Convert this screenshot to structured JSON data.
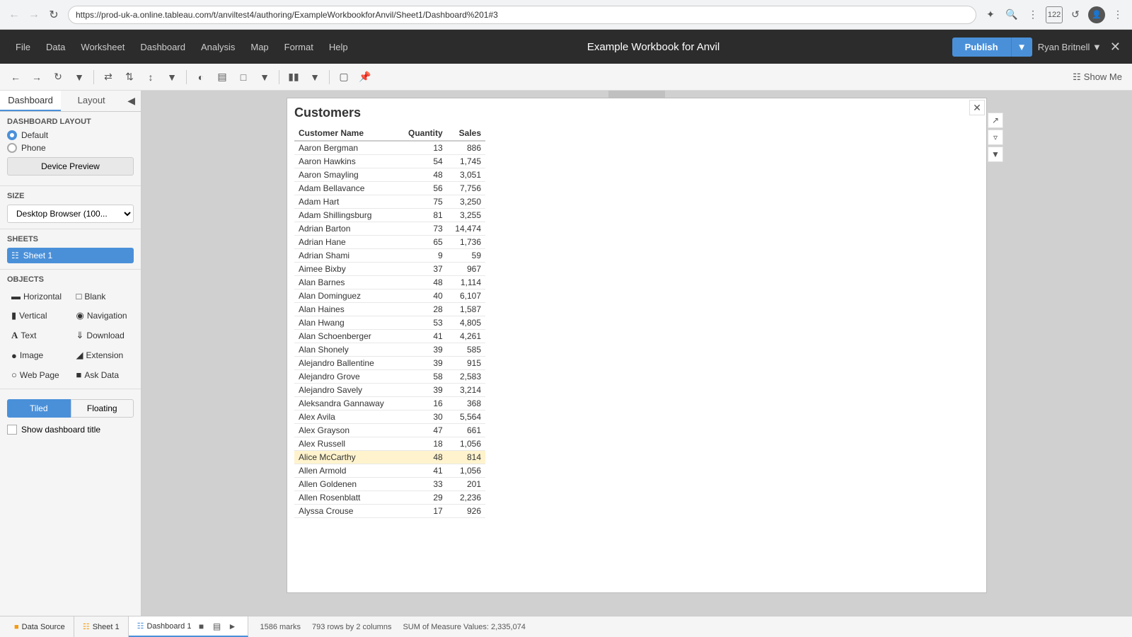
{
  "browser": {
    "url": "https://prod-uk-a.online.tableau.com/t/anviltest4/authoring/ExampleWorkbookforAnvil/Sheet1/Dashboard%201#3",
    "tab_count": "122"
  },
  "app": {
    "title": "Example Workbook for Anvil",
    "menu_items": [
      "File",
      "Data",
      "Worksheet",
      "Dashboard",
      "Analysis",
      "Map",
      "Format",
      "Help"
    ],
    "publish_label": "Publish",
    "user_name": "Ryan Britnell"
  },
  "left_panel": {
    "tab_dashboard": "Dashboard",
    "tab_layout": "Layout",
    "layout_section_title": "Dashboard Layout",
    "layout_options": [
      {
        "value": "default",
        "label": "Default"
      },
      {
        "value": "phone",
        "label": "Phone"
      }
    ],
    "device_preview_label": "Device Preview",
    "size_label": "Size",
    "size_value": "Desktop Browser (100...",
    "sheets_label": "Sheets",
    "sheet1_label": "Sheet 1",
    "objects_label": "Objects",
    "objects": [
      {
        "icon": "▬",
        "label": "Horizontal"
      },
      {
        "icon": "□",
        "label": "Blank"
      },
      {
        "icon": "▮",
        "label": "Vertical"
      },
      {
        "icon": "◎",
        "label": "Navigation"
      },
      {
        "icon": "A",
        "label": "Text"
      },
      {
        "icon": "⬇",
        "label": "Download"
      },
      {
        "icon": "🖼",
        "label": "Image"
      },
      {
        "icon": "⬢",
        "label": "Extension"
      },
      {
        "icon": "🌐",
        "label": "Web Page"
      },
      {
        "icon": "?",
        "label": "Ask Data"
      }
    ],
    "tiled_label": "Tiled",
    "floating_label": "Floating",
    "show_dashboard_title_label": "Show dashboard title"
  },
  "toolbar": {
    "show_me_label": "Show Me"
  },
  "sheet": {
    "title": "Customers",
    "columns": [
      "Customer Name",
      "Quantity",
      "Sales"
    ],
    "rows": [
      {
        "name": "Aaron Bergman",
        "qty": 13,
        "sales": "886"
      },
      {
        "name": "Aaron Hawkins",
        "qty": 54,
        "sales": "1,745"
      },
      {
        "name": "Aaron Smayling",
        "qty": 48,
        "sales": "3,051"
      },
      {
        "name": "Adam Bellavance",
        "qty": 56,
        "sales": "7,756"
      },
      {
        "name": "Adam Hart",
        "qty": 75,
        "sales": "3,250"
      },
      {
        "name": "Adam Shillingsburg",
        "qty": 81,
        "sales": "3,255"
      },
      {
        "name": "Adrian Barton",
        "qty": 73,
        "sales": "14,474"
      },
      {
        "name": "Adrian Hane",
        "qty": 65,
        "sales": "1,736"
      },
      {
        "name": "Adrian Shami",
        "qty": 9,
        "sales": "59"
      },
      {
        "name": "Aimee Bixby",
        "qty": 37,
        "sales": "967"
      },
      {
        "name": "Alan Barnes",
        "qty": 48,
        "sales": "1,114"
      },
      {
        "name": "Alan Dominguez",
        "qty": 40,
        "sales": "6,107"
      },
      {
        "name": "Alan Haines",
        "qty": 28,
        "sales": "1,587"
      },
      {
        "name": "Alan Hwang",
        "qty": 53,
        "sales": "4,805"
      },
      {
        "name": "Alan Schoenberger",
        "qty": 41,
        "sales": "4,261"
      },
      {
        "name": "Alan Shonely",
        "qty": 39,
        "sales": "585"
      },
      {
        "name": "Alejandro Ballentine",
        "qty": 39,
        "sales": "915"
      },
      {
        "name": "Alejandro Grove",
        "qty": 58,
        "sales": "2,583"
      },
      {
        "name": "Alejandro Savely",
        "qty": 39,
        "sales": "3,214"
      },
      {
        "name": "Aleksandra Gannaway",
        "qty": 16,
        "sales": "368"
      },
      {
        "name": "Alex Avila",
        "qty": 30,
        "sales": "5,564"
      },
      {
        "name": "Alex Grayson",
        "qty": 47,
        "sales": "661"
      },
      {
        "name": "Alex Russell",
        "qty": 18,
        "sales": "1,056"
      },
      {
        "name": "Alice McCarthy",
        "qty": 48,
        "sales": "814",
        "highlight": true
      },
      {
        "name": "Allen Armold",
        "qty": 41,
        "sales": "1,056"
      },
      {
        "name": "Allen Goldenen",
        "qty": 33,
        "sales": "201"
      },
      {
        "name": "Allen Rosenblatt",
        "qty": 29,
        "sales": "2,236"
      },
      {
        "name": "Alyssa Crouse",
        "qty": 17,
        "sales": "926"
      }
    ]
  },
  "status_bar": {
    "data_source_label": "Data Source",
    "sheet1_label": "Sheet 1",
    "dashboard1_label": "Dashboard 1",
    "marks_info": "1586 marks",
    "rows_info": "793 rows by 2 columns",
    "sum_info": "SUM of Measure Values: 2,335,074"
  }
}
